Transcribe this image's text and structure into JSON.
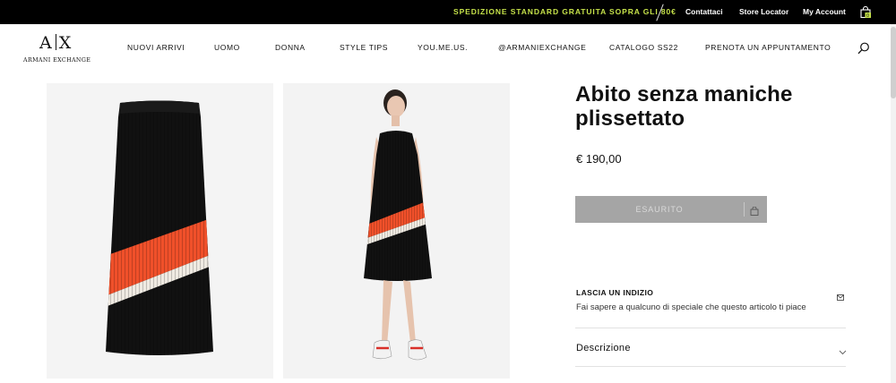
{
  "topbar": {
    "promo": "SPEDIZIONE STANDARD GRATUITA SOPRA GLI 80€",
    "links": [
      "Contattaci",
      "Store Locator",
      "My Account"
    ],
    "cart_count": "0",
    "icons": {
      "bag": "shopping-bag-icon"
    }
  },
  "header": {
    "logo_mark": "A X",
    "logo_text": "ARMANI EXCHANGE",
    "nav": [
      "NUOVI ARRIVI",
      "UOMO",
      "DONNA",
      "STYLE TIPS",
      "YOU.ME.US.",
      "@ARMANIEXCHANGE",
      "CATALOGO SS22",
      "PRENOTA UN APPUNTAMENTO"
    ],
    "icons": {
      "search": "search-icon"
    }
  },
  "product": {
    "title": "Abito senza maniche plissettato",
    "price": "€ 190,00",
    "soldout_label": "ESAURITO",
    "hint_title": "LASCIA UN INDIZIO",
    "hint_text": "Fai sapere a qualcuno di speciale che questo articolo ti piace",
    "description_label": "Descrizione",
    "icons": {
      "soldout": "shopping-bag-icon",
      "hint": "envelope-icon",
      "description": "chevron-down-icon"
    }
  },
  "colors": {
    "accent": "#c6e24a",
    "topbar_bg": "#000000",
    "soldout_bg": "#a5a5a5",
    "dress_black": "#111111",
    "dress_orange": "#f0502a",
    "dress_cream": "#efeae2"
  }
}
